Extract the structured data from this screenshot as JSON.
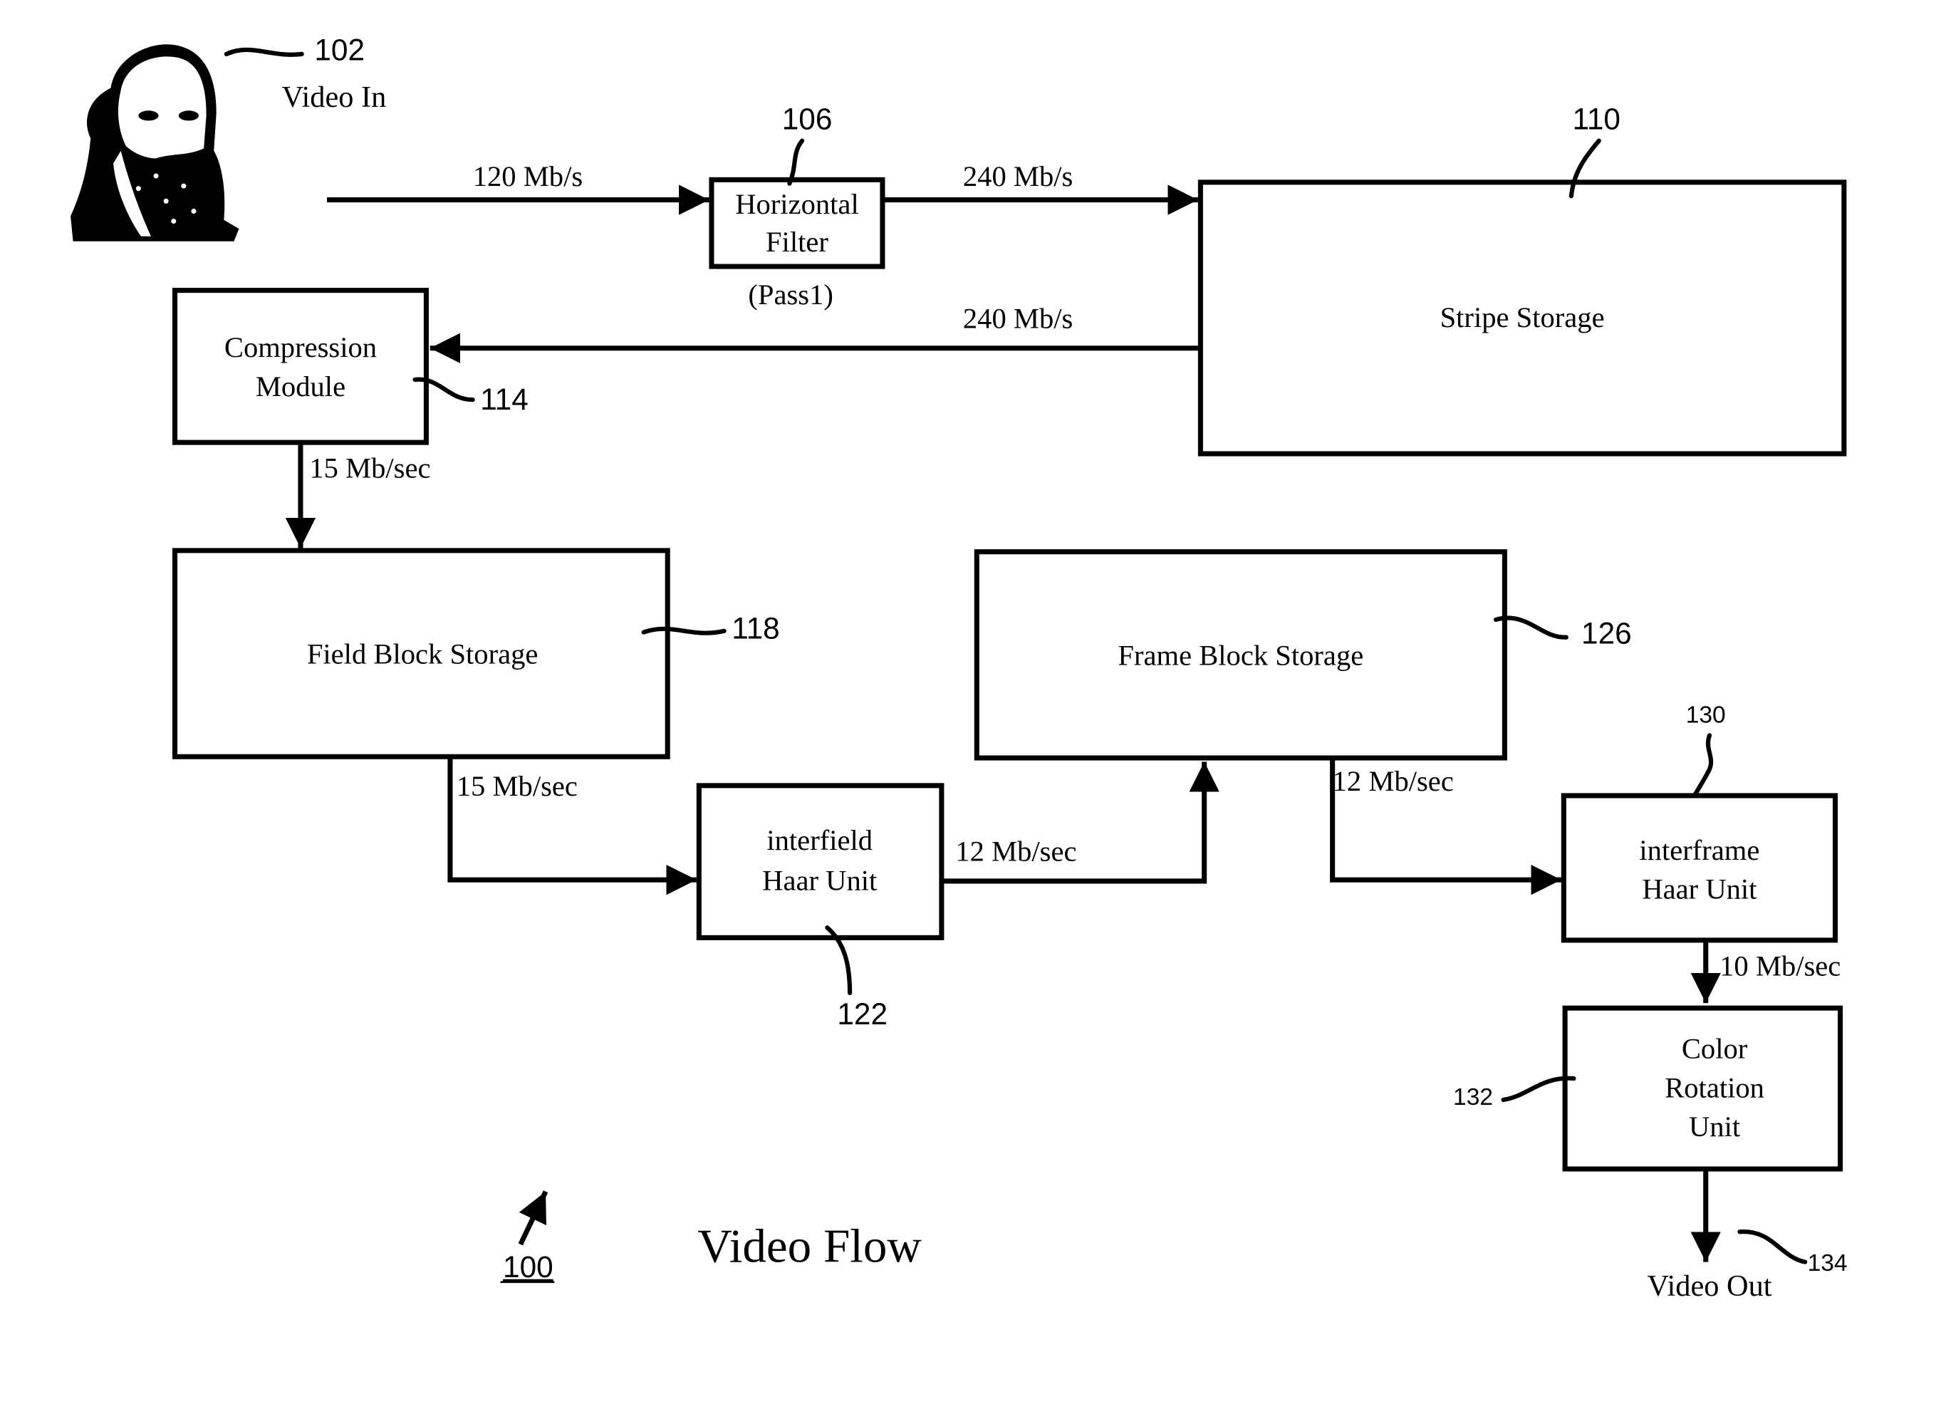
{
  "diagram": {
    "title": "Video Flow",
    "figure_ref": "100",
    "input": {
      "label": "Video In",
      "ref": "102",
      "icon": "portrait-photo-icon"
    },
    "output": {
      "label": "Video Out",
      "ref": "134"
    },
    "blocks": {
      "horizontal_filter": {
        "lines": [
          "Horizontal",
          "Filter"
        ],
        "note": "(Pass1)",
        "ref": "106"
      },
      "stripe_storage": {
        "lines": [
          "Stripe Storage"
        ],
        "ref": "110"
      },
      "compression_module": {
        "lines": [
          "Compression",
          "Module"
        ],
        "ref": "114"
      },
      "field_block_storage": {
        "lines": [
          "Field Block Storage"
        ],
        "ref": "118"
      },
      "interfield_haar": {
        "lines": [
          "interfield",
          "Haar Unit"
        ],
        "ref": "122"
      },
      "frame_block_storage": {
        "lines": [
          "Frame Block Storage"
        ],
        "ref": "126"
      },
      "interframe_haar": {
        "lines": [
          "interframe",
          "Haar Unit"
        ],
        "ref": "130"
      },
      "color_rotation": {
        "lines": [
          "Color",
          "Rotation",
          "Unit"
        ],
        "ref": "132"
      }
    },
    "rates": {
      "video_in_to_filter": "120 Mb/s",
      "filter_to_stripe": "240 Mb/s",
      "stripe_to_compression": "240 Mb/s",
      "compression_to_field": "15 Mb/sec",
      "field_to_interfield": "15 Mb/sec",
      "interfield_to_frame": "12 Mb/sec",
      "frame_to_interframe": "12 Mb/sec",
      "interframe_to_color": "10 Mb/sec"
    }
  }
}
